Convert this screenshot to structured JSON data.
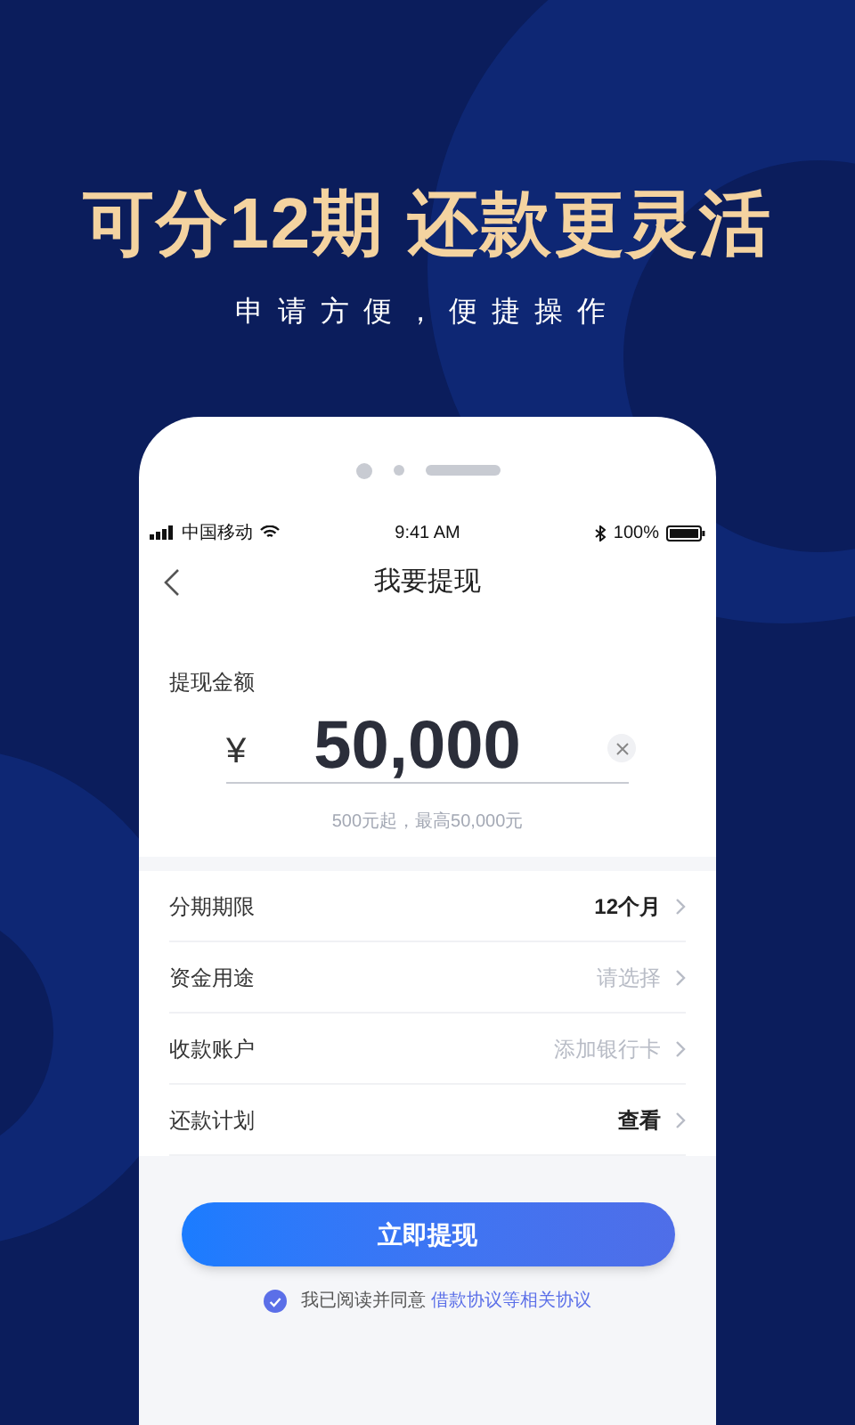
{
  "headline": "可分12期 还款更灵活",
  "subtitle": "申请方便，便捷操作",
  "status_bar": {
    "carrier": "中国移动",
    "time": "9:41 AM",
    "battery": "100%"
  },
  "nav": {
    "title": "我要提现"
  },
  "amount": {
    "label": "提现金额",
    "currency": "¥",
    "value": "50,000",
    "hint": "500元起，最高50,000元"
  },
  "rows": [
    {
      "label": "分期期限",
      "value": "12个月",
      "kind": "set"
    },
    {
      "label": "资金用途",
      "value": "请选择",
      "kind": "placeholder"
    },
    {
      "label": "收款账户",
      "value": "添加银行卡",
      "kind": "placeholder"
    },
    {
      "label": "还款计划",
      "value": "查看",
      "kind": "set"
    }
  ],
  "button": "立即提现",
  "agreement": {
    "checked": true,
    "text": "我已阅读并同意",
    "link": "借款协议等相关协议"
  }
}
